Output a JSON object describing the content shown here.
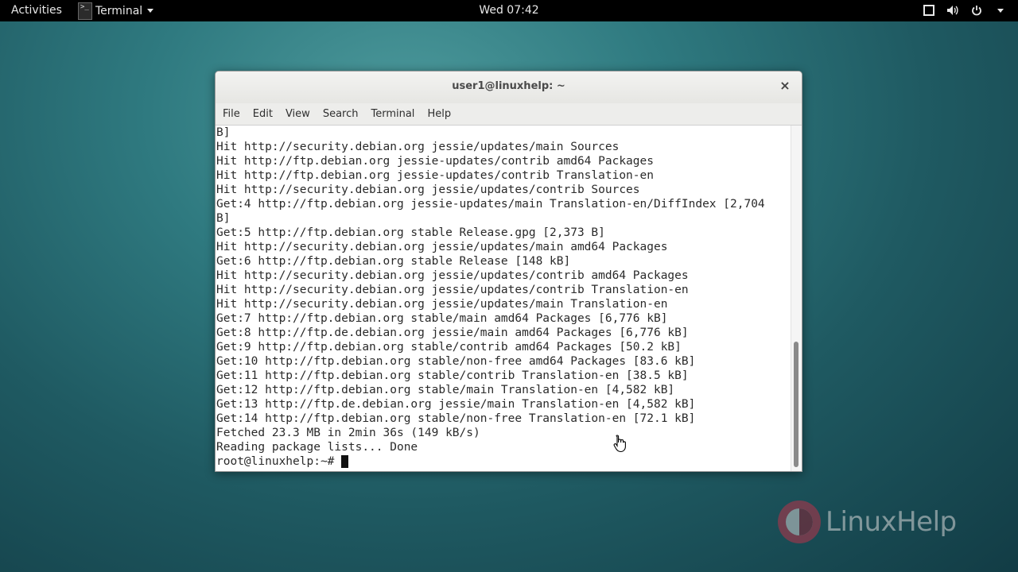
{
  "topbar": {
    "activities": "Activities",
    "app_name": "Terminal",
    "clock": "Wed 07:42",
    "icons": [
      "window-icon",
      "volume-icon",
      "power-icon",
      "chevron-down-icon"
    ]
  },
  "window": {
    "title": "user1@linuxhelp: ~",
    "menu": [
      "File",
      "Edit",
      "View",
      "Search",
      "Terminal",
      "Help"
    ],
    "lines": [
      "B]",
      "Hit http://security.debian.org jessie/updates/main Sources",
      "Hit http://ftp.debian.org jessie-updates/contrib amd64 Packages",
      "Hit http://ftp.debian.org jessie-updates/contrib Translation-en",
      "Hit http://security.debian.org jessie/updates/contrib Sources",
      "Get:4 http://ftp.debian.org jessie-updates/main Translation-en/DiffIndex [2,704",
      "B]",
      "Get:5 http://ftp.debian.org stable Release.gpg [2,373 B]",
      "Hit http://security.debian.org jessie/updates/main amd64 Packages",
      "Get:6 http://ftp.debian.org stable Release [148 kB]",
      "Hit http://security.debian.org jessie/updates/contrib amd64 Packages",
      "Hit http://security.debian.org jessie/updates/contrib Translation-en",
      "Hit http://security.debian.org jessie/updates/main Translation-en",
      "Get:7 http://ftp.debian.org stable/main amd64 Packages [6,776 kB]",
      "Get:8 http://ftp.de.debian.org jessie/main amd64 Packages [6,776 kB]",
      "Get:9 http://ftp.debian.org stable/contrib amd64 Packages [50.2 kB]",
      "Get:10 http://ftp.debian.org stable/non-free amd64 Packages [83.6 kB]",
      "Get:11 http://ftp.debian.org stable/contrib Translation-en [38.5 kB]",
      "Get:12 http://ftp.debian.org stable/main Translation-en [4,582 kB]",
      "Get:13 http://ftp.de.debian.org jessie/main Translation-en [4,582 kB]",
      "Get:14 http://ftp.debian.org stable/non-free Translation-en [72.1 kB]",
      "Fetched 23.3 MB in 2min 36s (149 kB/s)",
      "Reading package lists... Done"
    ],
    "prompt": "root@linuxhelp:~# "
  },
  "watermark": {
    "text": "LinuxHelp"
  },
  "colors": {
    "desktop": "#2f7a80",
    "topbar": "#000000",
    "terminal_bg": "#ffffff",
    "text": "#2a2a2a"
  }
}
